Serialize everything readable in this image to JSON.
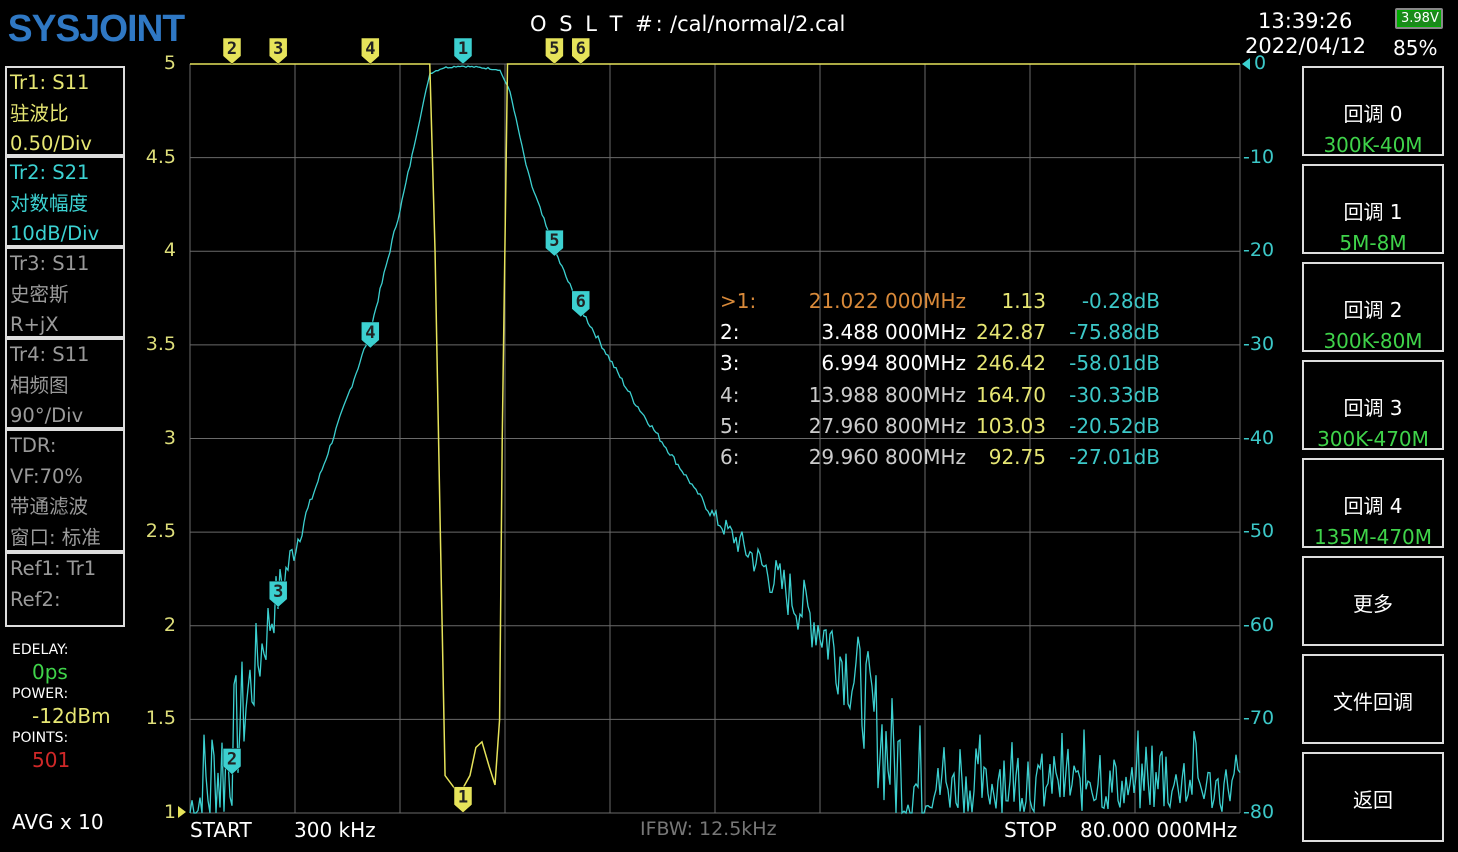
{
  "header": {
    "brand": "SYSJOINT",
    "cal_prefix": "O S L T #:",
    "cal_file": "/cal/normal/2.cal",
    "time": "13:39:26",
    "date": "2022/04/12",
    "battery_voltage": "3.98V",
    "battery_percent": "85%"
  },
  "traces": [
    {
      "lines": [
        "Tr1:   S11",
        "驻波比",
        "0.50/Div"
      ],
      "color": "#e6e673"
    },
    {
      "lines": [
        "Tr2:   S21",
        "对数幅度",
        "10dB/Div"
      ],
      "color": "#3cd2d2"
    },
    {
      "lines": [
        "Tr3:   S11",
        "史密斯",
        "R+jX"
      ],
      "color": "#9a9a9a"
    },
    {
      "lines": [
        "Tr4:   S11",
        "相频图",
        "90°/Div"
      ],
      "color": "#9a9a9a"
    },
    {
      "lines": [
        "TDR:",
        "VF:70%",
        "带通滤波",
        "窗口: 标准"
      ],
      "color": "#9a9a9a"
    },
    {
      "lines": [
        "Ref1:  Tr1",
        "Ref2:"
      ],
      "color": "#9a9a9a"
    }
  ],
  "settings": {
    "edelay_label": "EDELAY:",
    "edelay": "0ps",
    "power_label": "POWER:",
    "power": "-12dBm",
    "points_label": "POINTS:",
    "points": "501",
    "avg": "AVG x 10"
  },
  "colors": {
    "s11": "#e6e35a",
    "s21": "#3cd0d0",
    "grid": "#6a6a6a",
    "active_marker": "#d98a3a",
    "green": "#3fd34a",
    "red": "#d02828"
  },
  "axis_left": {
    "ticks": [
      "5",
      "4.5",
      "4",
      "3.5",
      "3",
      "2.5",
      "2",
      "1.5",
      "1"
    ],
    "min": 1,
    "max": 5
  },
  "axis_right": {
    "ticks": [
      "0",
      "-10",
      "-20",
      "-30",
      "-40",
      "-50",
      "-60",
      "-70",
      "-80"
    ],
    "min": -80,
    "max": 0
  },
  "sweep": {
    "start_label": "START",
    "start": "300 kHz",
    "stop_label": "STOP",
    "stop": "80.000 000MHz",
    "ifbw": "IFBW: 12.5kHz",
    "start_mhz": 0.3,
    "stop_mhz": 80
  },
  "markers": [
    {
      "id": "1",
      "label": ">1:",
      "freq": "21.022 000MHz",
      "vswr": "1.13",
      "db": "-0.28dB",
      "f": 21.022,
      "v": 1.13,
      "d": -0.28,
      "active": true
    },
    {
      "id": "2",
      "label": "2:",
      "freq": "3.488 000MHz",
      "vswr": "242.87",
      "db": "-75.88dB",
      "f": 3.488,
      "v": 242.87,
      "d": -75.88
    },
    {
      "id": "3",
      "label": "3:",
      "freq": "6.994 800MHz",
      "vswr": "246.42",
      "db": "-58.01dB",
      "f": 6.9948,
      "v": 246.42,
      "d": -58.01
    },
    {
      "id": "4",
      "label": "4:",
      "freq": "13.988 800MHz",
      "vswr": "164.70",
      "db": "-30.33dB",
      "f": 13.9888,
      "v": 164.7,
      "d": -30.33
    },
    {
      "id": "5",
      "label": "5:",
      "freq": "27.960 800MHz",
      "vswr": "103.03",
      "db": "-20.52dB",
      "f": 27.9608,
      "v": 103.03,
      "d": -20.52
    },
    {
      "id": "6",
      "label": "6:",
      "freq": "29.960 800MHz",
      "vswr": "92.75",
      "db": "-27.01dB",
      "f": 29.9608,
      "v": 92.75,
      "d": -27.01
    }
  ],
  "s21_points": [
    [
      0.3,
      -80
    ],
    [
      3.26,
      -74
    ],
    [
      6.9,
      -57
    ],
    [
      13.9,
      -29
    ],
    [
      16.5,
      -14
    ],
    [
      18.5,
      -1
    ],
    [
      19.5,
      -0.4
    ],
    [
      20.8,
      -0.2
    ],
    [
      22.5,
      -0.4
    ],
    [
      23.8,
      -0.6
    ],
    [
      24.6,
      -3
    ],
    [
      26,
      -12
    ],
    [
      27.85,
      -19.5
    ],
    [
      29.7,
      -25.5
    ],
    [
      34,
      -36
    ],
    [
      40.15,
      -48.5
    ],
    [
      44,
      -54
    ],
    [
      48.1,
      -60
    ],
    [
      51,
      -66
    ],
    [
      53.4,
      -74
    ],
    [
      56.1,
      -78.6
    ]
  ],
  "s21_noise_floor": [
    -80,
    -71
  ],
  "s11_points": [
    [
      0.3,
      5
    ],
    [
      18.5,
      5
    ],
    [
      18.9,
      4
    ],
    [
      19.3,
      2.5
    ],
    [
      19.66,
      1.2
    ],
    [
      20.4,
      1.13
    ],
    [
      21.0,
      1.13
    ],
    [
      21.55,
      1.2
    ],
    [
      22.0,
      1.35
    ],
    [
      22.46,
      1.38
    ],
    [
      23.0,
      1.25
    ],
    [
      23.45,
      1.15
    ],
    [
      23.8,
      1.5
    ],
    [
      24.0,
      3
    ],
    [
      24.4,
      5
    ],
    [
      80,
      5
    ]
  ],
  "buttons": [
    {
      "title": "回调 0",
      "sub": "300K-40M"
    },
    {
      "title": "回调 1",
      "sub": "5M-8M"
    },
    {
      "title": "回调 2",
      "sub": "300K-80M"
    },
    {
      "title": "回调 3",
      "sub": "300K-470M"
    },
    {
      "title": "回调 4",
      "sub": "135M-470M"
    },
    {
      "title": "更多"
    },
    {
      "title": "文件回调"
    },
    {
      "title": "返回"
    }
  ]
}
